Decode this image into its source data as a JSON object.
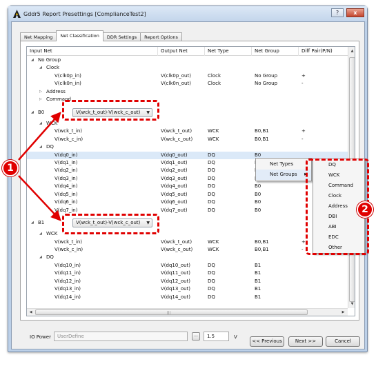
{
  "window": {
    "title": "Gddr5 Report Presettings [ComplianceTest2]",
    "help": "?",
    "close": "x"
  },
  "tabs": [
    "Net Mapping",
    "Net Classification",
    "DDR Settings",
    "Report Options"
  ],
  "columns": [
    "Input Net",
    "Output Net",
    "Net Type",
    "Net Group",
    "Diff Pair(P/N)"
  ],
  "rows": [
    {
      "tw": "◢",
      "input": "No Group",
      "output": "",
      "type": "",
      "group": "",
      "diff": "",
      "indent": 0
    },
    {
      "tw": "◢",
      "input": "Clock",
      "output": "",
      "type": "",
      "group": "",
      "diff": "",
      "indent": 1
    },
    {
      "tw": "",
      "input": "V(clk0p_in)",
      "output": "V(clk0p_out)",
      "type": "Clock",
      "group": "No Group",
      "diff": "+",
      "indent": 2
    },
    {
      "tw": "",
      "input": "V(clk0n_in)",
      "output": "V(clk0n_out)",
      "type": "Clock",
      "group": "No Group",
      "diff": "-",
      "indent": 2
    },
    {
      "tw": "▷",
      "input": "Address",
      "output": "",
      "type": "",
      "group": "",
      "diff": "",
      "indent": 1
    },
    {
      "tw": "▷",
      "input": "Command",
      "output": "",
      "type": "",
      "group": "",
      "diff": "",
      "indent": 1
    },
    {
      "tw": "◢",
      "input": "B0",
      "output": "",
      "type": "",
      "group": "",
      "diff": "",
      "indent": 0,
      "combo": "V(wck_t_out)-V(wck_c_out)"
    },
    {
      "tw": "◢",
      "input": "WCK",
      "output": "",
      "type": "",
      "group": "",
      "diff": "",
      "indent": 1
    },
    {
      "tw": "",
      "input": "V(wck_t_in)",
      "output": "V(wck_t_out)",
      "type": "WCK",
      "group": "B0,B1",
      "diff": "+",
      "indent": 2
    },
    {
      "tw": "",
      "input": "V(wck_c_in)",
      "output": "V(wck_c_out)",
      "type": "WCK",
      "group": "B0,B1",
      "diff": "-",
      "indent": 2
    },
    {
      "tw": "◢",
      "input": "DQ",
      "output": "",
      "type": "",
      "group": "",
      "diff": "",
      "indent": 1
    },
    {
      "tw": "",
      "input": "V(dq0_in)",
      "output": "V(dq0_out)",
      "type": "DQ",
      "group": "B0",
      "diff": "",
      "indent": 2,
      "selected": true
    },
    {
      "tw": "",
      "input": "V(dq1_in)",
      "output": "V(dq1_out)",
      "type": "DQ",
      "group": "B0",
      "diff": "",
      "indent": 2
    },
    {
      "tw": "",
      "input": "V(dq2_in)",
      "output": "V(dq2_out)",
      "type": "DQ",
      "group": "B0",
      "diff": "",
      "indent": 2
    },
    {
      "tw": "",
      "input": "V(dq3_in)",
      "output": "V(dq3_out)",
      "type": "DQ",
      "group": "B0",
      "diff": "",
      "indent": 2
    },
    {
      "tw": "",
      "input": "V(dq4_in)",
      "output": "V(dq4_out)",
      "type": "DQ",
      "group": "B0",
      "diff": "",
      "indent": 2
    },
    {
      "tw": "",
      "input": "V(dq5_in)",
      "output": "V(dq5_out)",
      "type": "DQ",
      "group": "B0",
      "diff": "",
      "indent": 2
    },
    {
      "tw": "",
      "input": "V(dq6_in)",
      "output": "V(dq6_out)",
      "type": "DQ",
      "group": "B0",
      "diff": "",
      "indent": 2
    },
    {
      "tw": "",
      "input": "V(dq7_in)",
      "output": "V(dq7_out)",
      "type": "DQ",
      "group": "B0",
      "diff": "",
      "indent": 2
    },
    {
      "tw": "◢",
      "input": "B1",
      "output": "",
      "type": "",
      "group": "",
      "diff": "",
      "indent": 0,
      "combo": "V(wck_t_out)-V(wck_c_out)"
    },
    {
      "tw": "◢",
      "input": "WCK",
      "output": "",
      "type": "",
      "group": "",
      "diff": "",
      "indent": 1
    },
    {
      "tw": "",
      "input": "V(wck_t_in)",
      "output": "V(wck_t_out)",
      "type": "WCK",
      "group": "B0,B1",
      "diff": "+",
      "indent": 2
    },
    {
      "tw": "",
      "input": "V(wck_c_in)",
      "output": "V(wck_c_out)",
      "type": "WCK",
      "group": "B0,B1",
      "diff": "-",
      "indent": 2
    },
    {
      "tw": "◢",
      "input": "DQ",
      "output": "",
      "type": "",
      "group": "",
      "diff": "",
      "indent": 1
    },
    {
      "tw": "",
      "input": "V(dq10_in)",
      "output": "V(dq10_out)",
      "type": "DQ",
      "group": "B1",
      "diff": "",
      "indent": 2
    },
    {
      "tw": "",
      "input": "V(dq11_in)",
      "output": "V(dq11_out)",
      "type": "DQ",
      "group": "B1",
      "diff": "",
      "indent": 2
    },
    {
      "tw": "",
      "input": "V(dq12_in)",
      "output": "V(dq12_out)",
      "type": "DQ",
      "group": "B1",
      "diff": "",
      "indent": 2
    },
    {
      "tw": "",
      "input": "V(dq13_in)",
      "output": "V(dq13_out)",
      "type": "DQ",
      "group": "B1",
      "diff": "",
      "indent": 2
    },
    {
      "tw": "",
      "input": "V(dq14_in)",
      "output": "V(dq14_out)",
      "type": "DQ",
      "group": "B1",
      "diff": "",
      "indent": 2
    }
  ],
  "context_menu": {
    "items": [
      "Net Types",
      "Net Groups"
    ]
  },
  "submenu": {
    "items": [
      "DQ",
      "WCK",
      "Command",
      "Clock",
      "Address",
      "DBI",
      "ABI",
      "EDC",
      "Other"
    ]
  },
  "annotations": {
    "badge1": "1",
    "badge2": "2",
    "highlight_color": "#e00000"
  },
  "io_power": {
    "label": "IO Power",
    "value": "UserDefine",
    "browse": "...",
    "voltage": "1.5",
    "unit": "V"
  },
  "buttons": {
    "previous": "<< Previous",
    "next": "Next >>",
    "cancel": "Cancel"
  },
  "icons": {
    "tree_expanded": "triangle-down",
    "tree_collapsed": "triangle-right",
    "submenu_arrow": "triangle-right",
    "dropdown": "triangle-down"
  }
}
